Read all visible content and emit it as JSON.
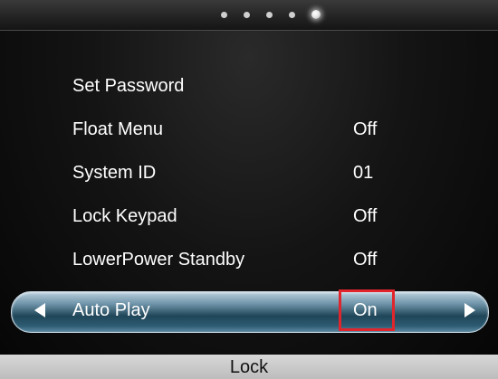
{
  "pagination": {
    "total_pages": 5,
    "current_page": 5
  },
  "menu": {
    "items": [
      {
        "label": "Set Password",
        "value": ""
      },
      {
        "label": "Float Menu",
        "value": "Off"
      },
      {
        "label": "System ID",
        "value": "01"
      },
      {
        "label": "Lock Keypad",
        "value": "Off"
      },
      {
        "label": "LowerPower Standby",
        "value": "Off"
      },
      {
        "label": "Auto Play",
        "value": "On",
        "selected": true
      }
    ]
  },
  "footer": {
    "label": "Lock"
  },
  "colors": {
    "highlight_box": "#e0262c",
    "selection_bar": "#2d5c73"
  },
  "icons": {
    "left": "left-arrow-icon",
    "right": "right-arrow-icon"
  }
}
